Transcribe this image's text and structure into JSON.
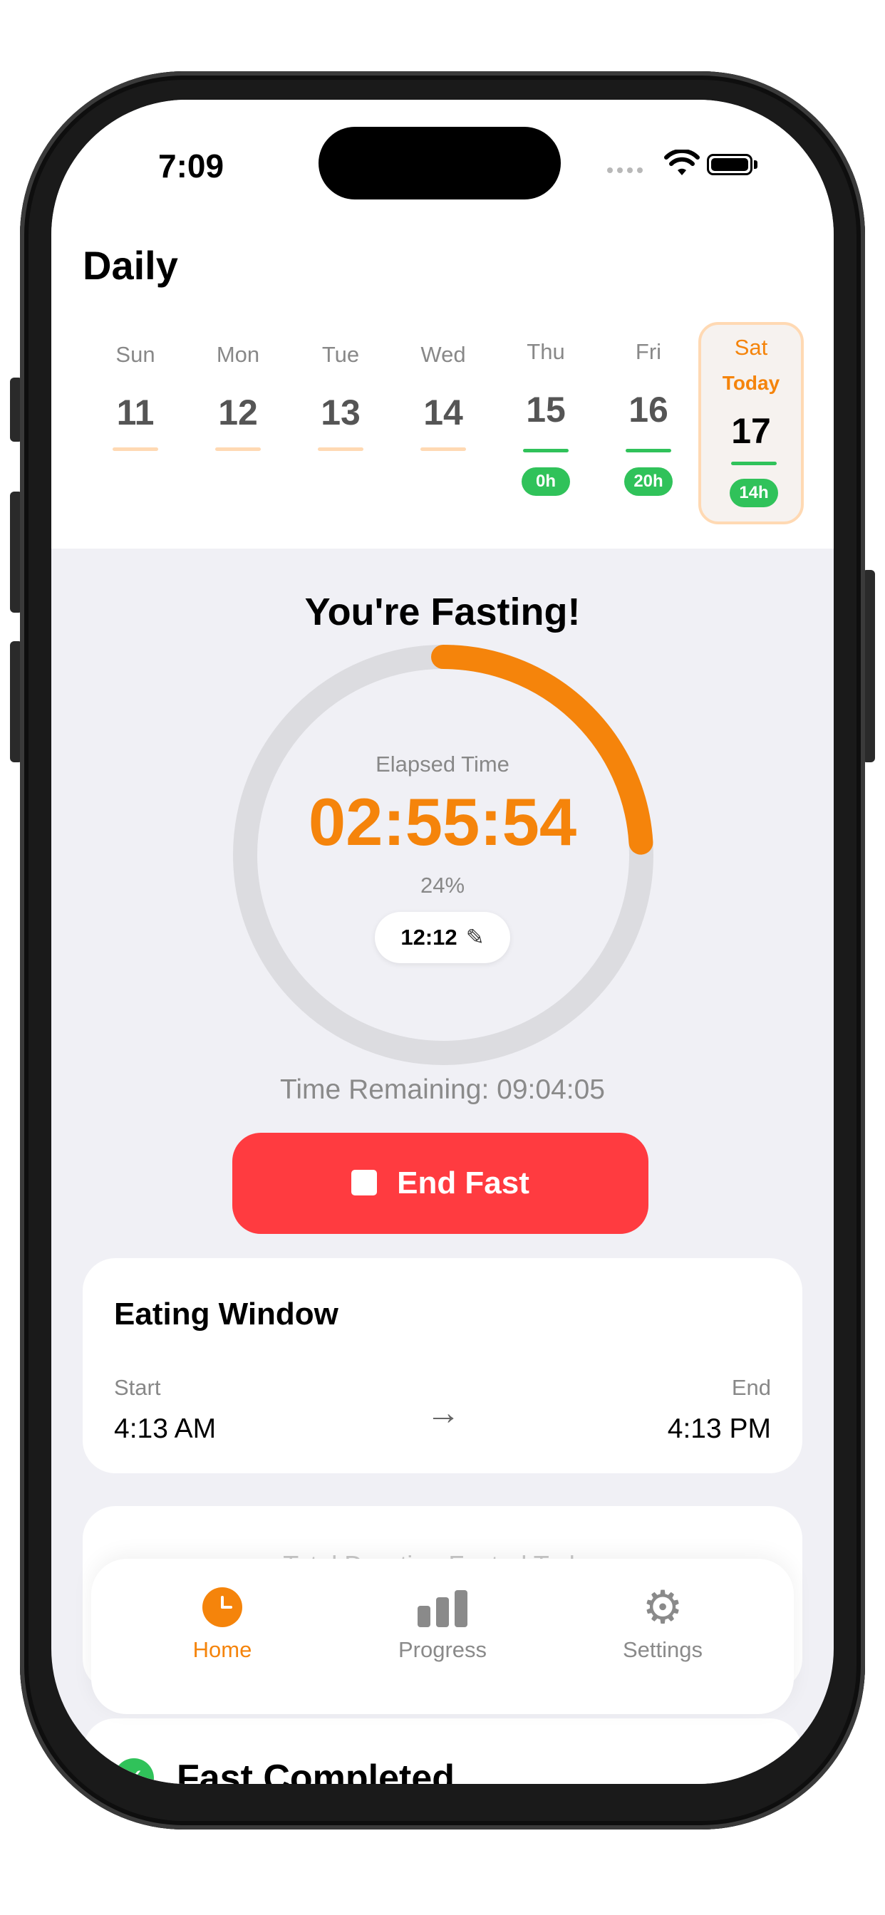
{
  "status_bar": {
    "time": "7:09"
  },
  "header": {
    "title": "Daily"
  },
  "days": [
    {
      "name": "Sun",
      "num": "11"
    },
    {
      "name": "Mon",
      "num": "12"
    },
    {
      "name": "Tue",
      "num": "13"
    },
    {
      "name": "Wed",
      "num": "14"
    },
    {
      "name": "Thu",
      "num": "15",
      "badge": "0h"
    },
    {
      "name": "Fri",
      "num": "16",
      "badge": "20h"
    },
    {
      "name": "Sat",
      "today_label": "Today",
      "num": "17",
      "badge": "14h"
    }
  ],
  "fasting": {
    "title": "You're Fasting!",
    "elapsed_label": "Elapsed Time",
    "elapsed": "02:55:54",
    "percent": "24%",
    "progress_fraction": 0.24,
    "plan": "12:12",
    "remaining": "Time Remaining: 09:04:05",
    "end_button": "End Fast"
  },
  "eating_window": {
    "title": "Eating Window",
    "start_label": "Start",
    "end_label": "End",
    "start_time": "4:13 AM",
    "end_time": "4:13 PM"
  },
  "total_card": {
    "title": "Total Duration Fasted Today"
  },
  "completed_card": {
    "title": "Fast Completed"
  },
  "tabbar": {
    "home": "Home",
    "progress": "Progress",
    "settings": "Settings"
  },
  "colors": {
    "accent": "#f5840b",
    "danger": "#ff3b40",
    "success": "#30c25a",
    "track": "#dcdce0"
  }
}
